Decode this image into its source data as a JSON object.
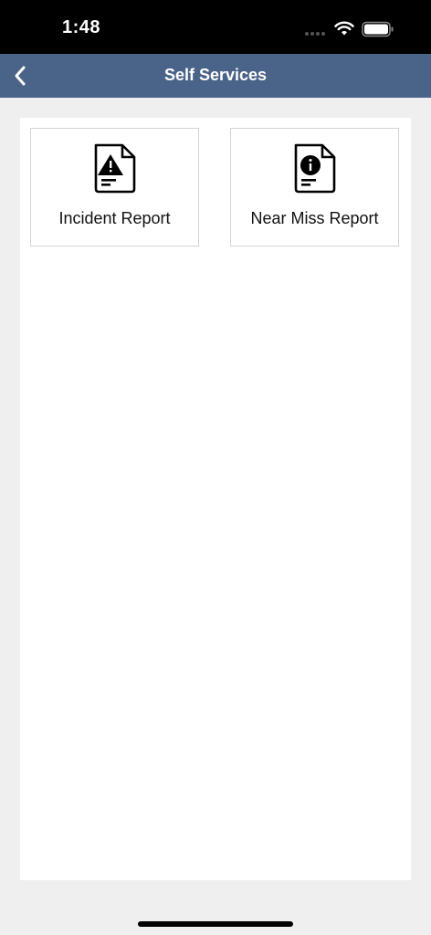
{
  "status_bar": {
    "time": "1:48",
    "icons": [
      "signal-dots-icon",
      "wifi-icon",
      "battery-icon"
    ]
  },
  "header": {
    "title": "Self Services",
    "back_icon": "chevron-left-icon"
  },
  "tiles": [
    {
      "label": "Incident Report",
      "icon": "document-warning-icon"
    },
    {
      "label": "Near Miss Report",
      "icon": "document-info-icon"
    }
  ],
  "colors": {
    "nav_bar": "#4a6388",
    "status_bar": "#000000",
    "background": "#efefef",
    "panel": "#ffffff",
    "tile_border": "#d4d4d4"
  }
}
